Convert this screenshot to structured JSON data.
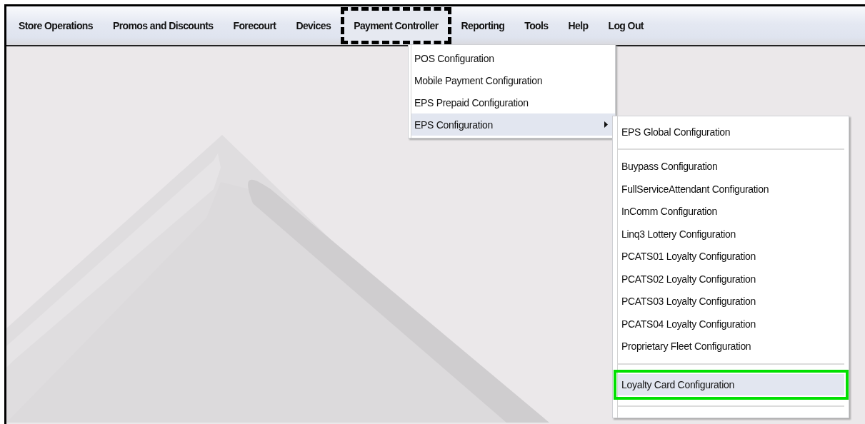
{
  "menubar": [
    {
      "label": "Store Operations",
      "selected": false,
      "outlined": false
    },
    {
      "label": "Promos and Discounts",
      "selected": false,
      "outlined": false
    },
    {
      "label": "Forecourt",
      "selected": false,
      "outlined": false
    },
    {
      "label": "Devices",
      "selected": false,
      "outlined": false
    },
    {
      "label": "Payment Controller",
      "selected": true,
      "outlined": true
    },
    {
      "label": "Reporting",
      "selected": false,
      "outlined": false
    },
    {
      "label": "Tools",
      "selected": false,
      "outlined": false
    },
    {
      "label": "Help",
      "selected": false,
      "outlined": false
    },
    {
      "label": "Log Out",
      "selected": false,
      "outlined": false
    }
  ],
  "dropdown": {
    "items": [
      {
        "label": "POS Configuration",
        "selected": false,
        "has_submenu": false
      },
      {
        "label": "Mobile Payment Configuration",
        "selected": false,
        "has_submenu": false
      },
      {
        "label": "EPS Prepaid Configuration",
        "selected": false,
        "has_submenu": false
      },
      {
        "label": "EPS Configuration",
        "selected": true,
        "has_submenu": true
      }
    ]
  },
  "submenu": {
    "items": [
      {
        "kind": "item",
        "label": "EPS Global Configuration",
        "selected": false,
        "outlined": false
      },
      {
        "kind": "separator"
      },
      {
        "kind": "item",
        "label": "Buypass Configuration",
        "selected": false,
        "outlined": false
      },
      {
        "kind": "item",
        "label": "FullServiceAttendant Configuration",
        "selected": false,
        "outlined": false
      },
      {
        "kind": "item",
        "label": "InComm Configuration",
        "selected": false,
        "outlined": false
      },
      {
        "kind": "item",
        "label": "Linq3 Lottery Configuration",
        "selected": false,
        "outlined": false
      },
      {
        "kind": "item",
        "label": "PCATS01 Loyalty Configuration",
        "selected": false,
        "outlined": false
      },
      {
        "kind": "item",
        "label": "PCATS02 Loyalty Configuration",
        "selected": false,
        "outlined": false
      },
      {
        "kind": "item",
        "label": "PCATS03 Loyalty Configuration",
        "selected": false,
        "outlined": false
      },
      {
        "kind": "item",
        "label": "PCATS04 Loyalty Configuration",
        "selected": false,
        "outlined": false
      },
      {
        "kind": "item",
        "label": "Proprietary Fleet Configuration",
        "selected": false,
        "outlined": false
      },
      {
        "kind": "separator"
      },
      {
        "kind": "item",
        "label": "Loyalty Card Configuration",
        "selected": true,
        "outlined": true
      },
      {
        "kind": "separator"
      }
    ]
  }
}
